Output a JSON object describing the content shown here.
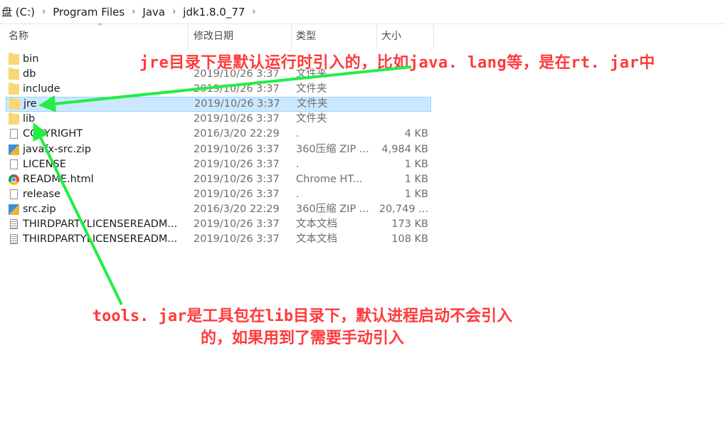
{
  "breadcrumb": {
    "items": [
      "盘 (C:)",
      "Program Files",
      "Java",
      "jdk1.8.0_77"
    ],
    "separator": "›"
  },
  "columns": {
    "name": "名称",
    "date": "修改日期",
    "type": "类型",
    "size": "大小",
    "sort_indicator": "^"
  },
  "files": [
    {
      "name": "bin",
      "date": "",
      "type": "",
      "size": "",
      "icon": "folder-icon"
    },
    {
      "name": "db",
      "date": "2019/10/26 3:37",
      "type": "文件夹",
      "size": "",
      "icon": "folder-icon"
    },
    {
      "name": "include",
      "date": "2019/10/26 3:37",
      "type": "文件夹",
      "size": "",
      "icon": "folder-icon"
    },
    {
      "name": "jre",
      "date": "2019/10/26 3:37",
      "type": "文件夹",
      "size": "",
      "icon": "folder-icon",
      "selected": true
    },
    {
      "name": "lib",
      "date": "2019/10/26 3:37",
      "type": "文件夹",
      "size": "",
      "icon": "folder-icon"
    },
    {
      "name": "COPYRIGHT",
      "date": "2016/3/20 22:29",
      "type": ".",
      "size": "4 KB",
      "icon": "file-icon"
    },
    {
      "name": "javafx-src.zip",
      "date": "2019/10/26 3:37",
      "type": "360压缩 ZIP ...",
      "size": "4,984 KB",
      "icon": "zip-icon"
    },
    {
      "name": "LICENSE",
      "date": "2019/10/26 3:37",
      "type": ".",
      "size": "1 KB",
      "icon": "file-icon"
    },
    {
      "name": "README.html",
      "date": "2019/10/26 3:37",
      "type": "Chrome HT...",
      "size": "1 KB",
      "icon": "chrome-icon"
    },
    {
      "name": "release",
      "date": "2019/10/26 3:37",
      "type": ".",
      "size": "1 KB",
      "icon": "file-icon"
    },
    {
      "name": "src.zip",
      "date": "2016/3/20 22:29",
      "type": "360压缩 ZIP ...",
      "size": "20,749 ...",
      "icon": "zip-icon"
    },
    {
      "name": "THIRDPARTYLICENSEREADM...",
      "date": "2019/10/26 3:37",
      "type": "文本文档",
      "size": "173 KB",
      "icon": "text-doc-icon"
    },
    {
      "name": "THIRDPARTYLICENSEREADM...",
      "date": "2019/10/26 3:37",
      "type": "文本文档",
      "size": "108 KB",
      "icon": "text-doc-icon"
    }
  ],
  "annotations": {
    "top": "jre目录下是默认运行时引入的，比如java. lang等，是在rt. jar中",
    "bottom_line1": "tools. jar是工具包在lib目录下，默认进程启动不会引入",
    "bottom_line2": "的，如果用到了需要手动引入"
  },
  "colors": {
    "annotation_text": "#ff3a3a",
    "arrow": "#22ee44",
    "selection_bg": "#cce8ff",
    "folder": "#f8d775"
  }
}
